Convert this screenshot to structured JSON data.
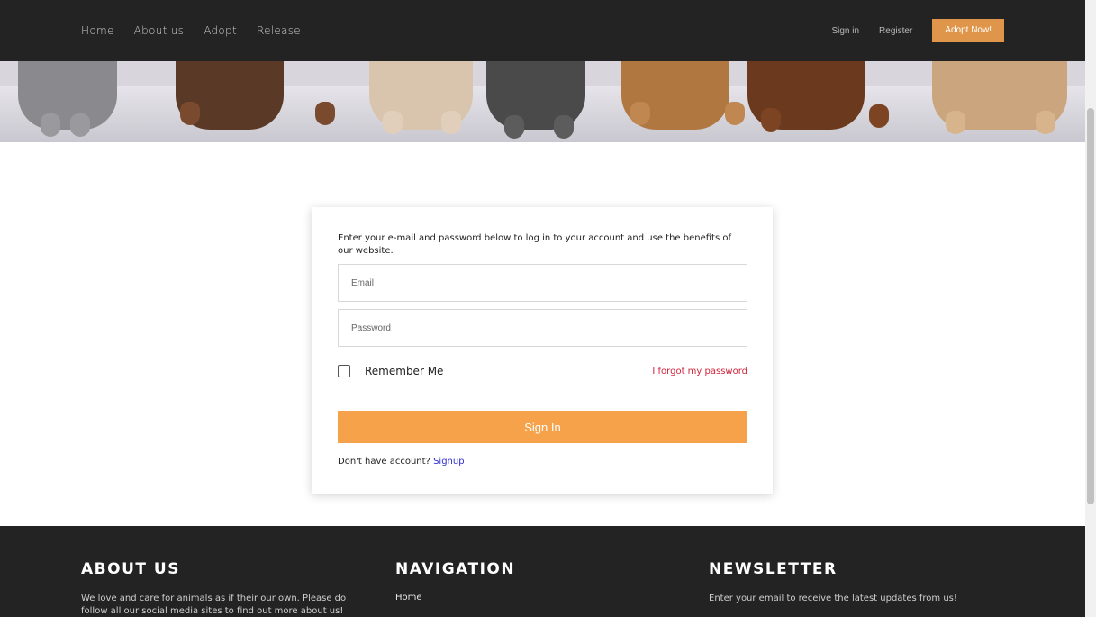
{
  "header": {
    "nav": [
      "Home",
      "About us",
      "Adopt",
      "Release"
    ],
    "signin_label": "Sign in",
    "register_label": "Register",
    "adopt_button": "Adopt Now!"
  },
  "login": {
    "intro": "Enter your e-mail and password below to log in to your account and use the benefits of our website.",
    "email_placeholder": "Email",
    "password_placeholder": "Password",
    "remember_label": "Remember Me",
    "forgot_label": "I forgot my password",
    "signin_button": "Sign In",
    "no_account_text": "Don't have account?",
    "signup_link": "Signup!"
  },
  "footer": {
    "about_title": "ABOUT US",
    "about_text": "We love and care for animals as if their our own. Please do follow all our social media sites to find out more about us!",
    "nav_title": "NAVIGATION",
    "nav_home": "Home",
    "newsletter_title": "NEWSLETTER",
    "newsletter_text": "Enter your email to receive the latest updates from us!"
  },
  "colors": {
    "header_bg": "#232323",
    "accent": "#f5a24a",
    "forgot_link": "#d0243a",
    "signup_link": "#2b2bd0"
  }
}
